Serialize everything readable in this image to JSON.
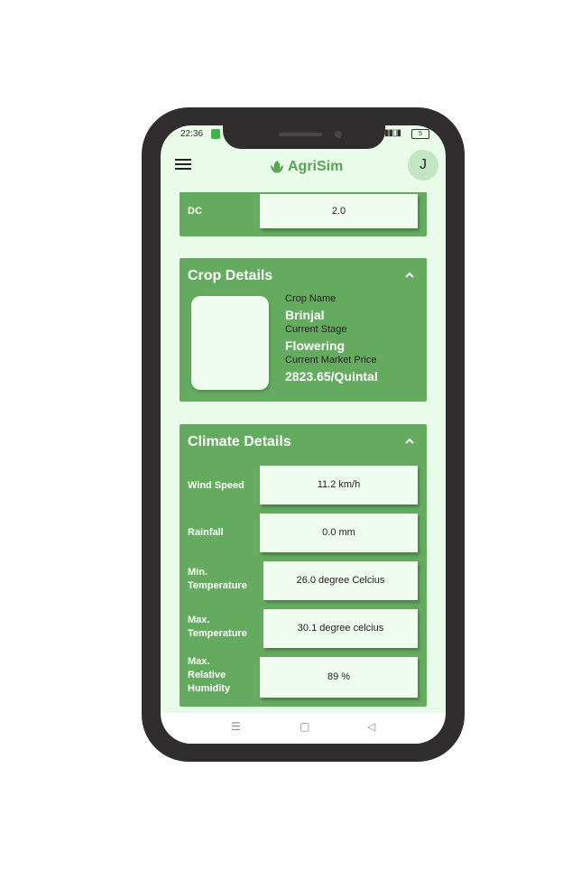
{
  "status_bar": {
    "time": "22:36",
    "battery": "5"
  },
  "app_bar": {
    "brand": "AgriSim",
    "avatar_initial": "J"
  },
  "dc_row": {
    "label": "DC",
    "value": "2.0"
  },
  "crop_details": {
    "title": "Crop Details",
    "crop_name_label": "Crop Name",
    "crop_name": "Brinjal",
    "stage_label": "Current Stage",
    "stage": "Flowering",
    "price_label": "Current Market Price",
    "price": "2823.65/Quintal"
  },
  "climate_details": {
    "title": "Climate Details",
    "rows": [
      {
        "label": "Wind Speed",
        "value": "11.2 km/h"
      },
      {
        "label": "Rainfall",
        "value": "0.0 mm"
      },
      {
        "label": "Min.\nTemperature",
        "value": "26.0 degree Celcius"
      },
      {
        "label": "Max.\nTemperature",
        "value": "30.1 degree celcius"
      },
      {
        "label": "Max.\nRelative\nHumidity",
        "value": "89 %"
      }
    ]
  },
  "colors": {
    "accent": "#64ab5f",
    "background": "#e9fbe9",
    "field": "#f0fcef",
    "phone": "#2f2d2e"
  },
  "nav": {
    "menu_icon": "hamburger-icon",
    "home_icon": "square-icon",
    "back_icon": "triangle-back-icon"
  }
}
